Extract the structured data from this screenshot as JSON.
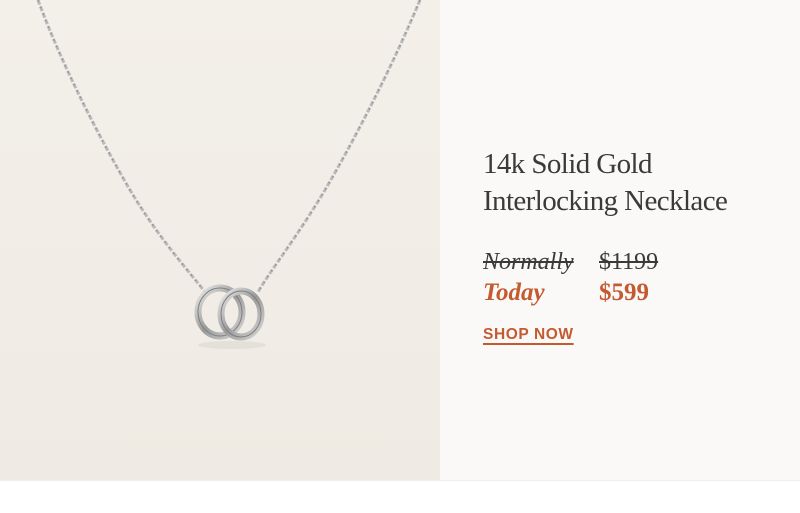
{
  "product": {
    "title_line1": "14k Solid Gold",
    "title_line2": "Interlocking Necklace",
    "normally_label": "Normally",
    "normally_price": "$1199",
    "today_label": "Today",
    "today_price": "$599",
    "cta_label": "SHOP NOW"
  },
  "colors": {
    "accent": "#c35a30",
    "text": "#3a3a3a",
    "photo_background": "#f2eee8"
  },
  "image": {
    "subject": "interlocking-rings-necklace"
  }
}
